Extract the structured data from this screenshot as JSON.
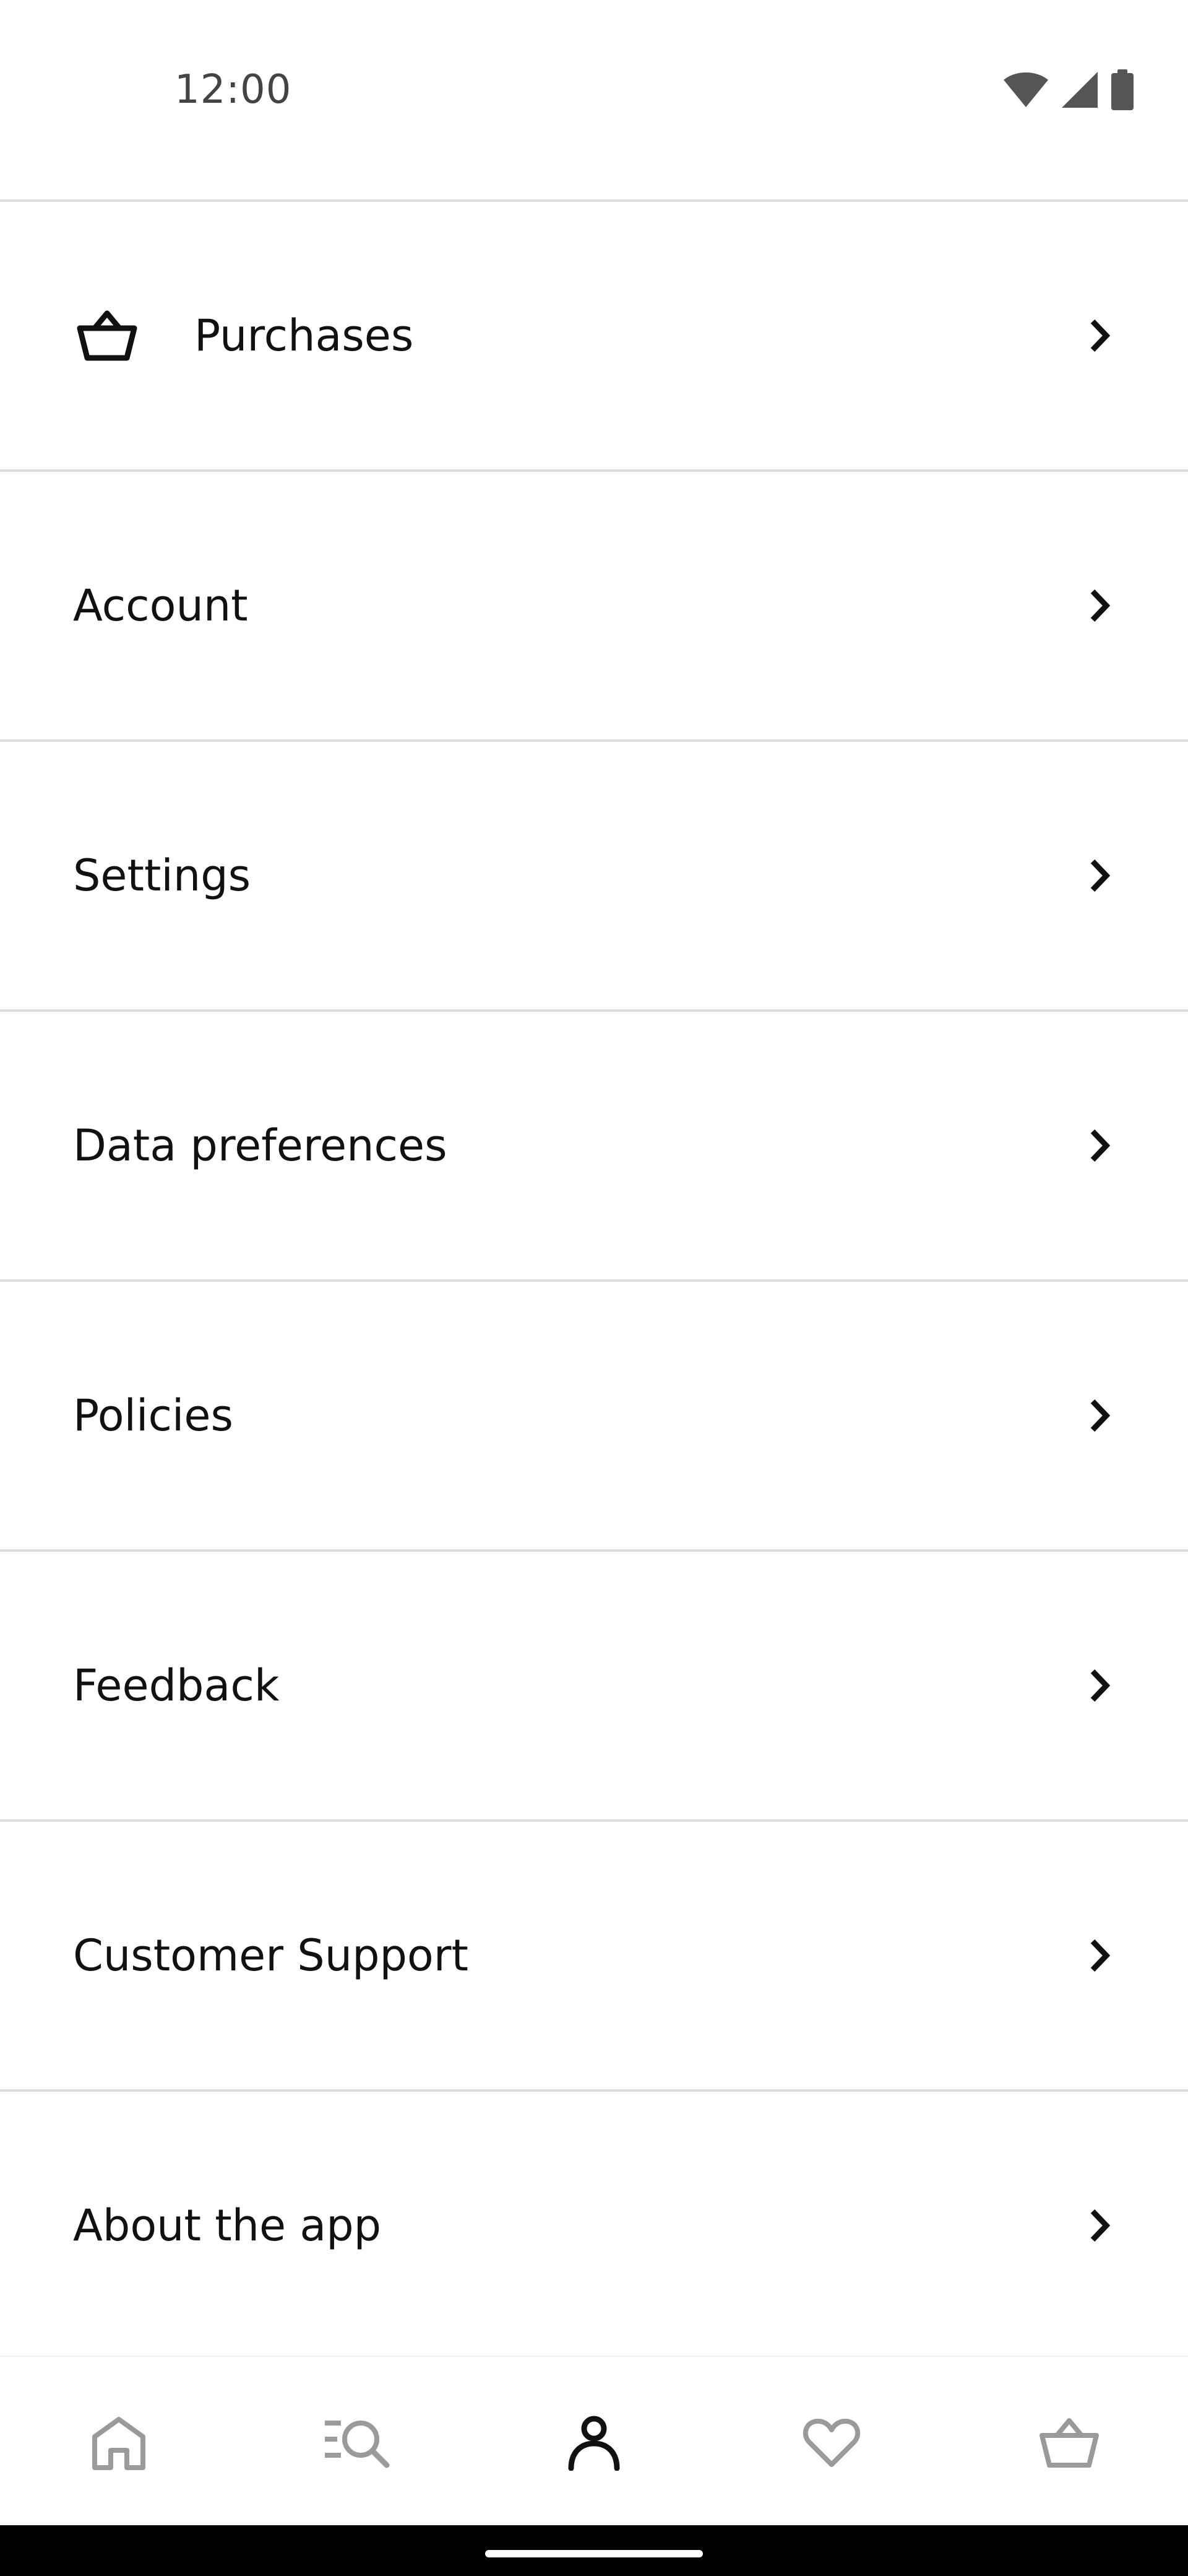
{
  "status_bar": {
    "time": "12:00",
    "icons": [
      "wifi-icon",
      "signal-icon",
      "battery-icon"
    ]
  },
  "menu": {
    "items": [
      {
        "label": "Purchases",
        "icon": "basket-icon"
      },
      {
        "label": "Account"
      },
      {
        "label": "Settings"
      },
      {
        "label": "Data preferences"
      },
      {
        "label": "Policies"
      },
      {
        "label": "Feedback"
      },
      {
        "label": "Customer Support"
      },
      {
        "label": "About the app"
      }
    ]
  },
  "bottom_nav": {
    "items": [
      {
        "icon": "home-icon",
        "active": false
      },
      {
        "icon": "search-list-icon",
        "active": false
      },
      {
        "icon": "profile-icon",
        "active": true
      },
      {
        "icon": "heart-icon",
        "active": false
      },
      {
        "icon": "cart-icon",
        "active": false
      }
    ],
    "colors": {
      "active": "#111111",
      "inactive": "#9a9a9a"
    }
  }
}
